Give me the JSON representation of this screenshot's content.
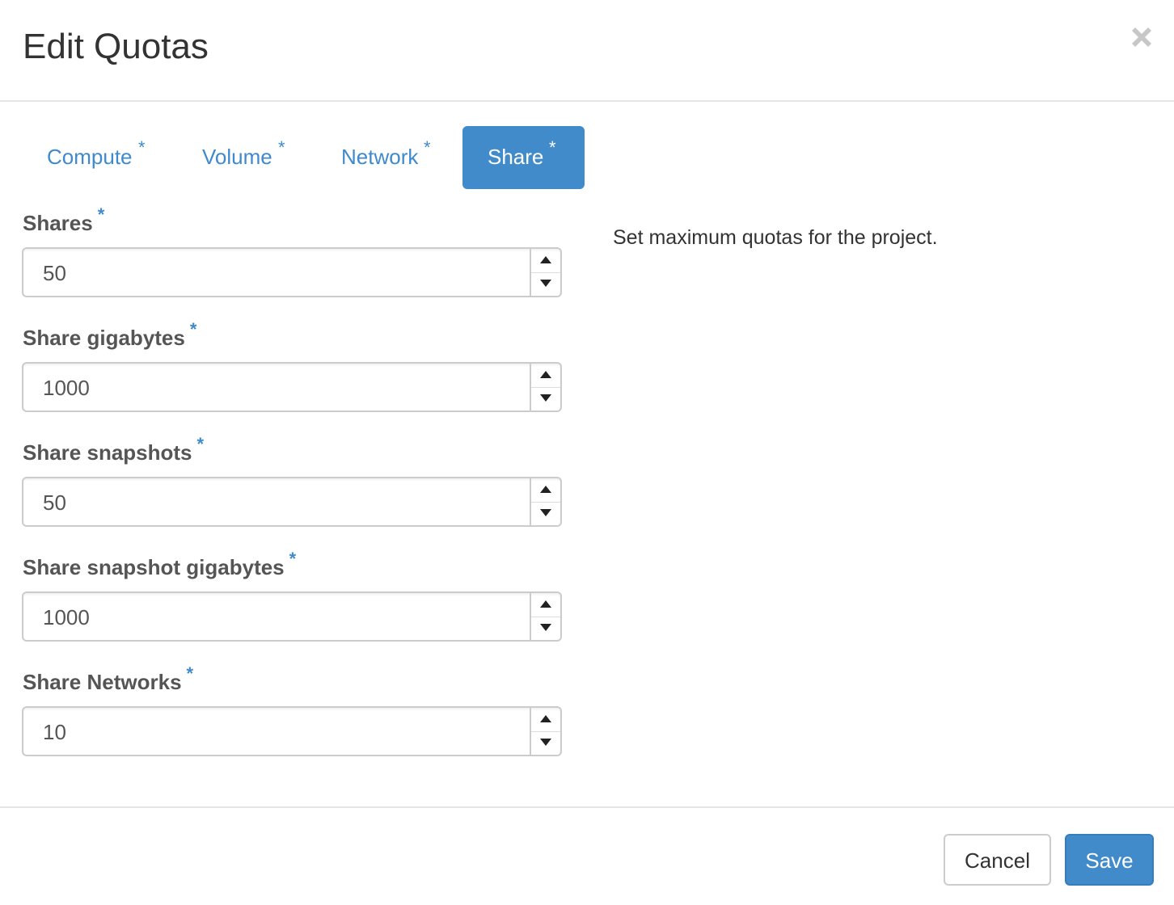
{
  "dialog": {
    "title": "Edit Quotas",
    "close_label": "×"
  },
  "tabs": [
    {
      "label": "Compute",
      "required": "*",
      "active": false
    },
    {
      "label": "Volume",
      "required": "*",
      "active": false
    },
    {
      "label": "Network",
      "required": "*",
      "active": false
    },
    {
      "label": "Share",
      "required": "*",
      "active": true
    }
  ],
  "fields": [
    {
      "label": "Shares",
      "required": "*",
      "value": "50"
    },
    {
      "label": "Share gigabytes",
      "required": "*",
      "value": "1000"
    },
    {
      "label": "Share snapshots",
      "required": "*",
      "value": "50"
    },
    {
      "label": "Share snapshot gigabytes",
      "required": "*",
      "value": "1000"
    },
    {
      "label": "Share Networks",
      "required": "*",
      "value": "10"
    }
  ],
  "help": {
    "text": "Set maximum quotas for the project."
  },
  "footer": {
    "cancel_label": "Cancel",
    "save_label": "Save"
  },
  "colors": {
    "accent": "#428bca",
    "link": "#3f8acd",
    "border": "#cccccc"
  },
  "icons": {
    "close": "close-icon",
    "increment": "caret-up-icon",
    "decrement": "caret-down-icon"
  }
}
